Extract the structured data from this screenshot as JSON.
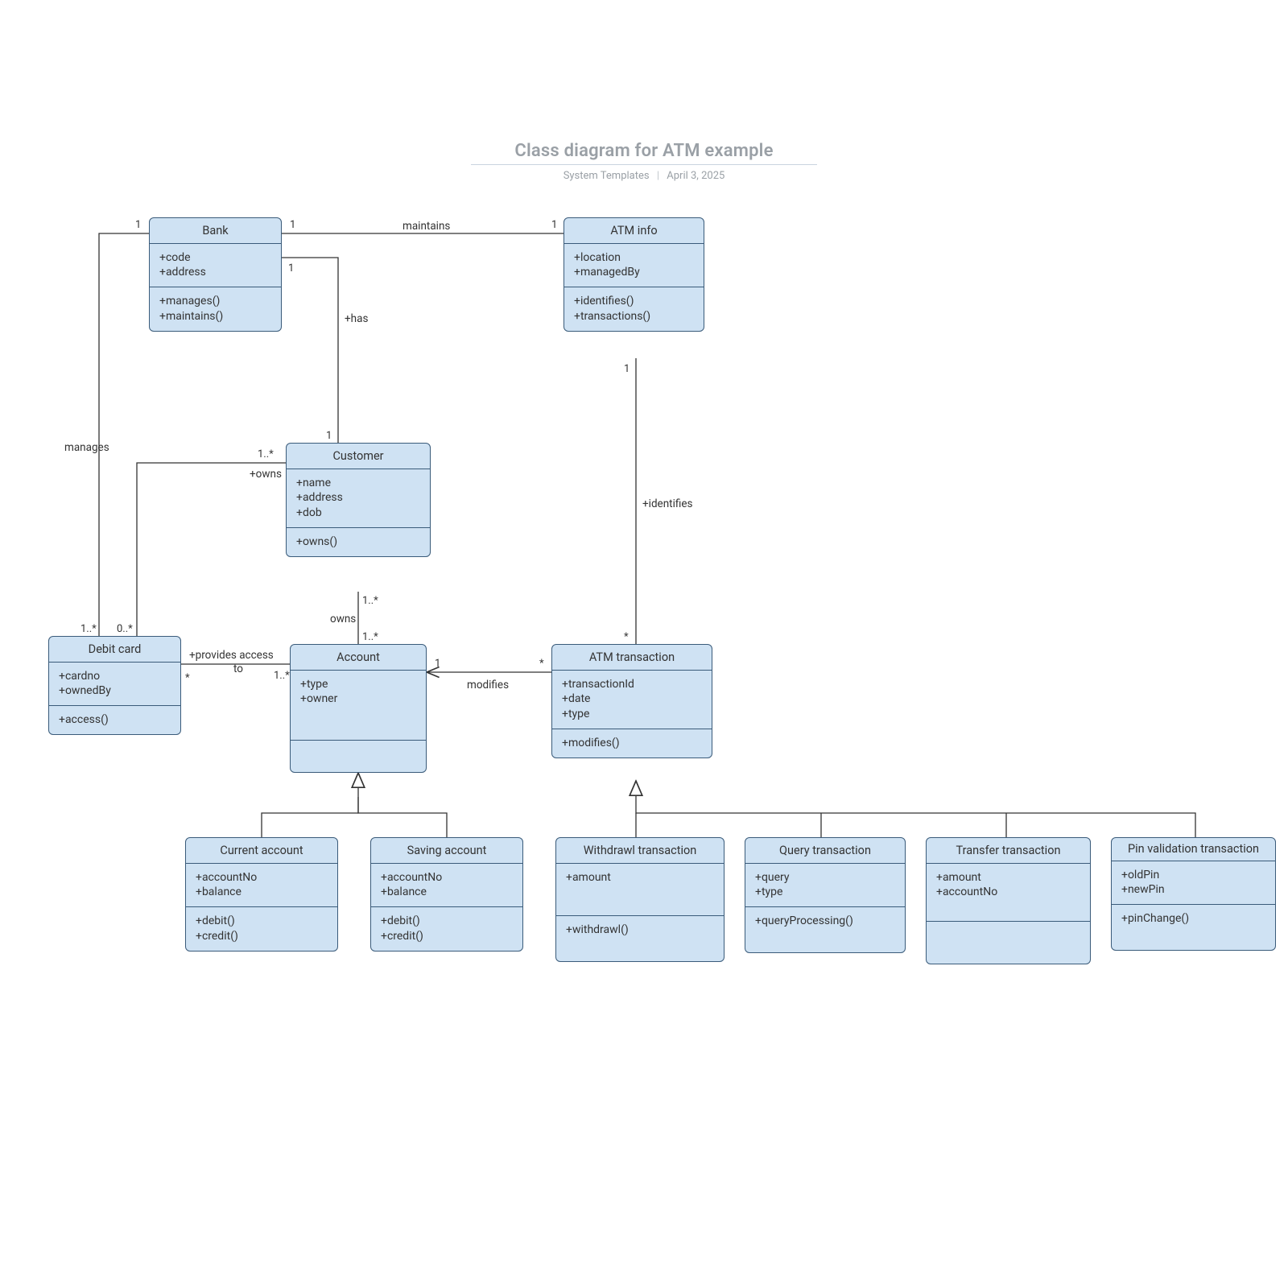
{
  "header": {
    "title": "Class diagram for ATM example",
    "subtitle_left": "System Templates",
    "subtitle_right": "April 3, 2025"
  },
  "classes": {
    "bank": {
      "name": "Bank",
      "attrs": [
        "+code",
        "+address"
      ],
      "ops": [
        "+manages()",
        "+maintains()"
      ]
    },
    "atminfo": {
      "name": "ATM info",
      "attrs": [
        "+location",
        "+managedBy"
      ],
      "ops": [
        "+identifies()",
        "+transactions()"
      ]
    },
    "customer": {
      "name": "Customer",
      "attrs": [
        "+name",
        "+address",
        "+dob"
      ],
      "ops": [
        "+owns()"
      ]
    },
    "debit": {
      "name": "Debit card",
      "attrs": [
        "+cardno",
        "+ownedBy"
      ],
      "ops": [
        "+access()"
      ]
    },
    "account": {
      "name": "Account",
      "attrs": [
        "+type",
        "+owner"
      ],
      "ops": []
    },
    "atmtx": {
      "name": "ATM transaction",
      "attrs": [
        "+transactionId",
        "+date",
        "+type"
      ],
      "ops": [
        "+modifies()"
      ]
    },
    "current": {
      "name": "Current account",
      "attrs": [
        "+accountNo",
        "+balance"
      ],
      "ops": [
        "+debit()",
        "+credit()"
      ]
    },
    "saving": {
      "name": "Saving account",
      "attrs": [
        "+accountNo",
        "+balance"
      ],
      "ops": [
        "+debit()",
        "+credit()"
      ]
    },
    "withdraw": {
      "name": "Withdrawl transaction",
      "attrs": [
        "+amount"
      ],
      "ops": [
        "+withdrawl()"
      ]
    },
    "query": {
      "name": "Query transaction",
      "attrs": [
        "+query",
        "+type"
      ],
      "ops": [
        "+queryProcessing()"
      ]
    },
    "transfer": {
      "name": "Transfer transaction",
      "attrs": [
        "+amount",
        "+accountNo"
      ],
      "ops": []
    },
    "pin": {
      "name": "Pin validation transaction",
      "attrs": [
        "+oldPin",
        "+newPin"
      ],
      "ops": [
        "+pinChange()"
      ]
    }
  },
  "relations": {
    "bank_atm": {
      "label": "maintains",
      "m_from": "1",
      "m_to": "1"
    },
    "bank_customer": {
      "label": "+has",
      "m_from": "1",
      "m_to": "1"
    },
    "bank_debit": {
      "label": "manages",
      "m_from": "1",
      "m_to": "1..*"
    },
    "customer_debit": {
      "label": "+owns",
      "m_from": "1..*",
      "m_to": "0..*"
    },
    "customer_acct": {
      "label": "owns",
      "m_from": "1..*",
      "m_to": "1..*"
    },
    "debit_account": {
      "label": "+provides access to",
      "m_from": "*",
      "m_to": "1..*"
    },
    "acct_atmtx": {
      "label": "modifies",
      "m_from": "1",
      "m_to": "*"
    },
    "atminfo_atmtx": {
      "label": "+identifies",
      "m_from": "1",
      "m_to": "*"
    }
  }
}
